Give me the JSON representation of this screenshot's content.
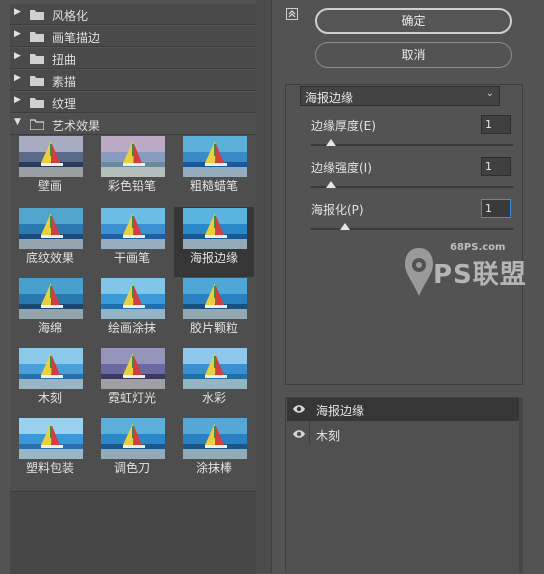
{
  "categories": [
    {
      "label": "风格化",
      "arrow": "▶",
      "expanded": false
    },
    {
      "label": "画笔描边",
      "arrow": "▶",
      "expanded": false
    },
    {
      "label": "扭曲",
      "arrow": "▶",
      "expanded": false
    },
    {
      "label": "素描",
      "arrow": "▶",
      "expanded": false
    },
    {
      "label": "纹理",
      "arrow": "▶",
      "expanded": false
    },
    {
      "label": "艺术效果",
      "arrow": "▼",
      "expanded": true
    }
  ],
  "thumbnails": [
    {
      "label": "壁画"
    },
    {
      "label": "彩色铅笔"
    },
    {
      "label": "粗糙蜡笔"
    },
    {
      "label": "底纹效果"
    },
    {
      "label": "干画笔"
    },
    {
      "label": "海报边缘",
      "selected": true
    },
    {
      "label": "海绵"
    },
    {
      "label": "绘画涂抹"
    },
    {
      "label": "胶片颗粒"
    },
    {
      "label": "木刻"
    },
    {
      "label": "霓虹灯光"
    },
    {
      "label": "水彩"
    },
    {
      "label": "塑料包装"
    },
    {
      "label": "调色刀"
    },
    {
      "label": "涂抹棒"
    }
  ],
  "buttons": {
    "ok": "确定",
    "cancel": "取消"
  },
  "filter_select": {
    "value": "海报边缘",
    "chevron": "⌄"
  },
  "params": [
    {
      "label": "边缘厚度(E)",
      "value": "1",
      "fraction": 0.1
    },
    {
      "label": "边缘强度(I)",
      "value": "1",
      "fraction": 0.1
    },
    {
      "label": "海报化(P)",
      "value": "1",
      "fraction": 0.167,
      "active": true
    }
  ],
  "layers": [
    {
      "name": "海报边缘",
      "selected": true
    },
    {
      "name": "木刻",
      "selected": false
    }
  ],
  "watermark": {
    "site": "68PS.com",
    "brand": "PS联盟"
  },
  "icons": {
    "collapse": "collapse-icon",
    "eye": "eye-icon",
    "folder": "folder-icon"
  }
}
